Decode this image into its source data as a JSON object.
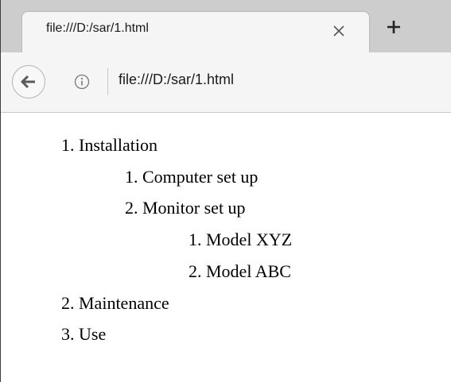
{
  "tab": {
    "title": "file:///D:/sar/1.html"
  },
  "address_bar": {
    "url": "file:///D:/sar/1.html"
  },
  "page": {
    "outline": [
      {
        "label": "1. Installation"
      },
      {
        "label": "1. Computer set up"
      },
      {
        "label": "2. Monitor set up"
      },
      {
        "label": "1. Model XYZ"
      },
      {
        "label": "2. Model ABC"
      },
      {
        "label": "2. Maintenance"
      },
      {
        "label": "3. Use"
      }
    ]
  },
  "colors": {
    "tabstrip": "#cdcdcd",
    "toolbar": "#f5f5f5",
    "text": "#000000"
  },
  "icons": {
    "close": "close-icon",
    "new_tab": "plus-icon",
    "back": "back-arrow-icon",
    "info": "info-icon"
  }
}
